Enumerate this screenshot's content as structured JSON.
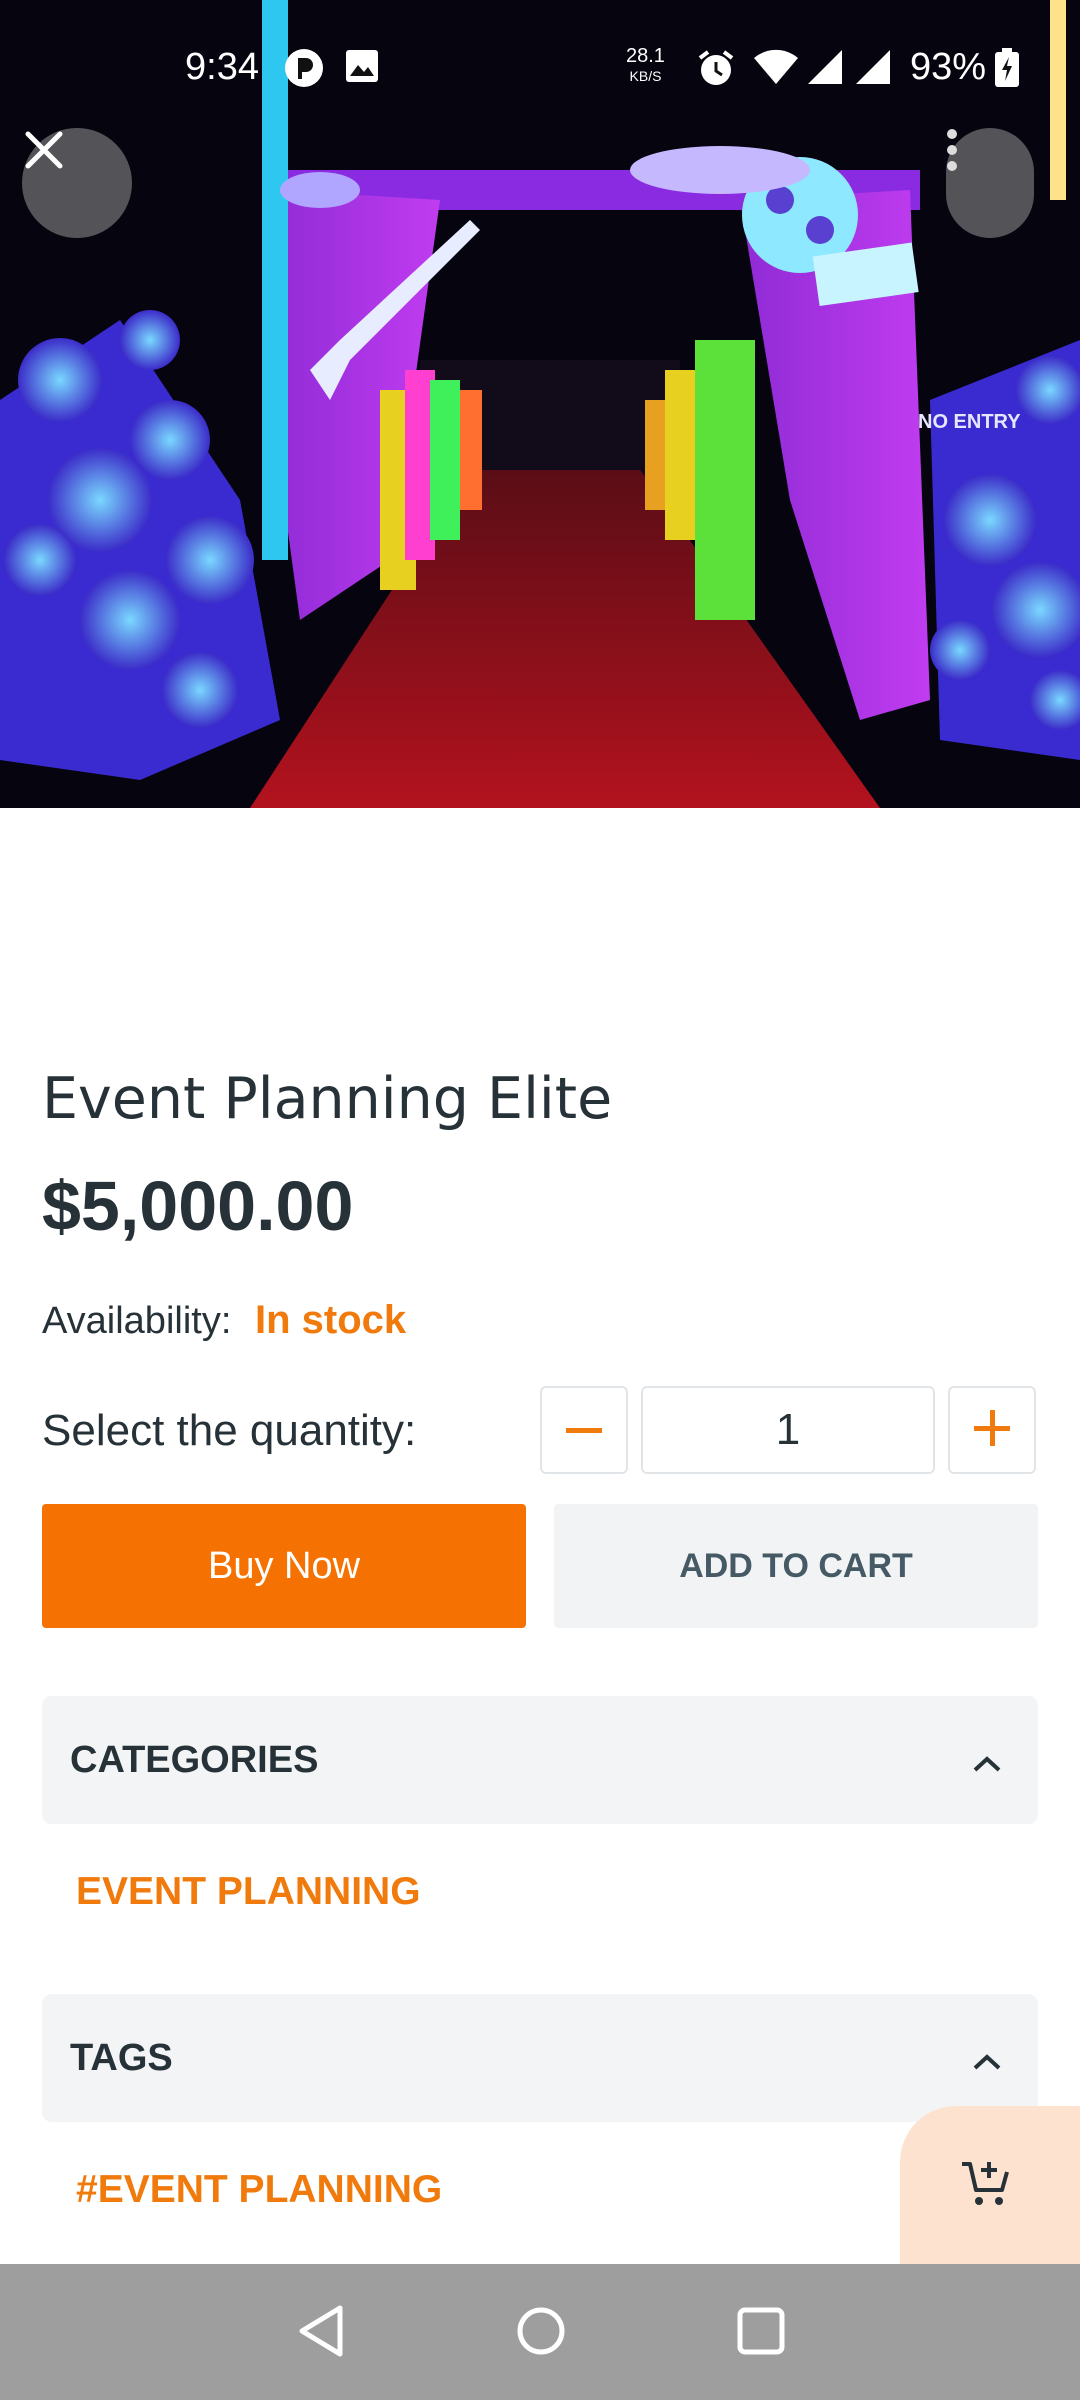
{
  "status_bar": {
    "time": "9:34",
    "net_speed_value": "28.1",
    "net_speed_unit": "KB/S",
    "battery": "93%"
  },
  "hero": {
    "sign_text": "NO ENTRY"
  },
  "product": {
    "title": "Event Planning Elite",
    "price": "$5,000.00",
    "availability_label": "Availability:",
    "availability_value": "In stock",
    "quantity_label": "Select the quantity:",
    "quantity_value": "1"
  },
  "actions": {
    "buy_now": "Buy Now",
    "add_to_cart": "ADD TO CART"
  },
  "categories": {
    "heading": "CATEGORIES",
    "items": [
      "EVENT PLANNING"
    ]
  },
  "tags": {
    "heading": "TAGS",
    "items": [
      "#EVENT PLANNING"
    ]
  },
  "colors": {
    "accent": "#f57202",
    "accent_text": "#f07a0c",
    "text": "#263238"
  },
  "icons": [
    "close-icon",
    "more-vert-icon",
    "minus-icon",
    "plus-icon",
    "chevron-up-icon",
    "add-cart-icon",
    "back-icon",
    "home-icon",
    "recents-icon"
  ]
}
